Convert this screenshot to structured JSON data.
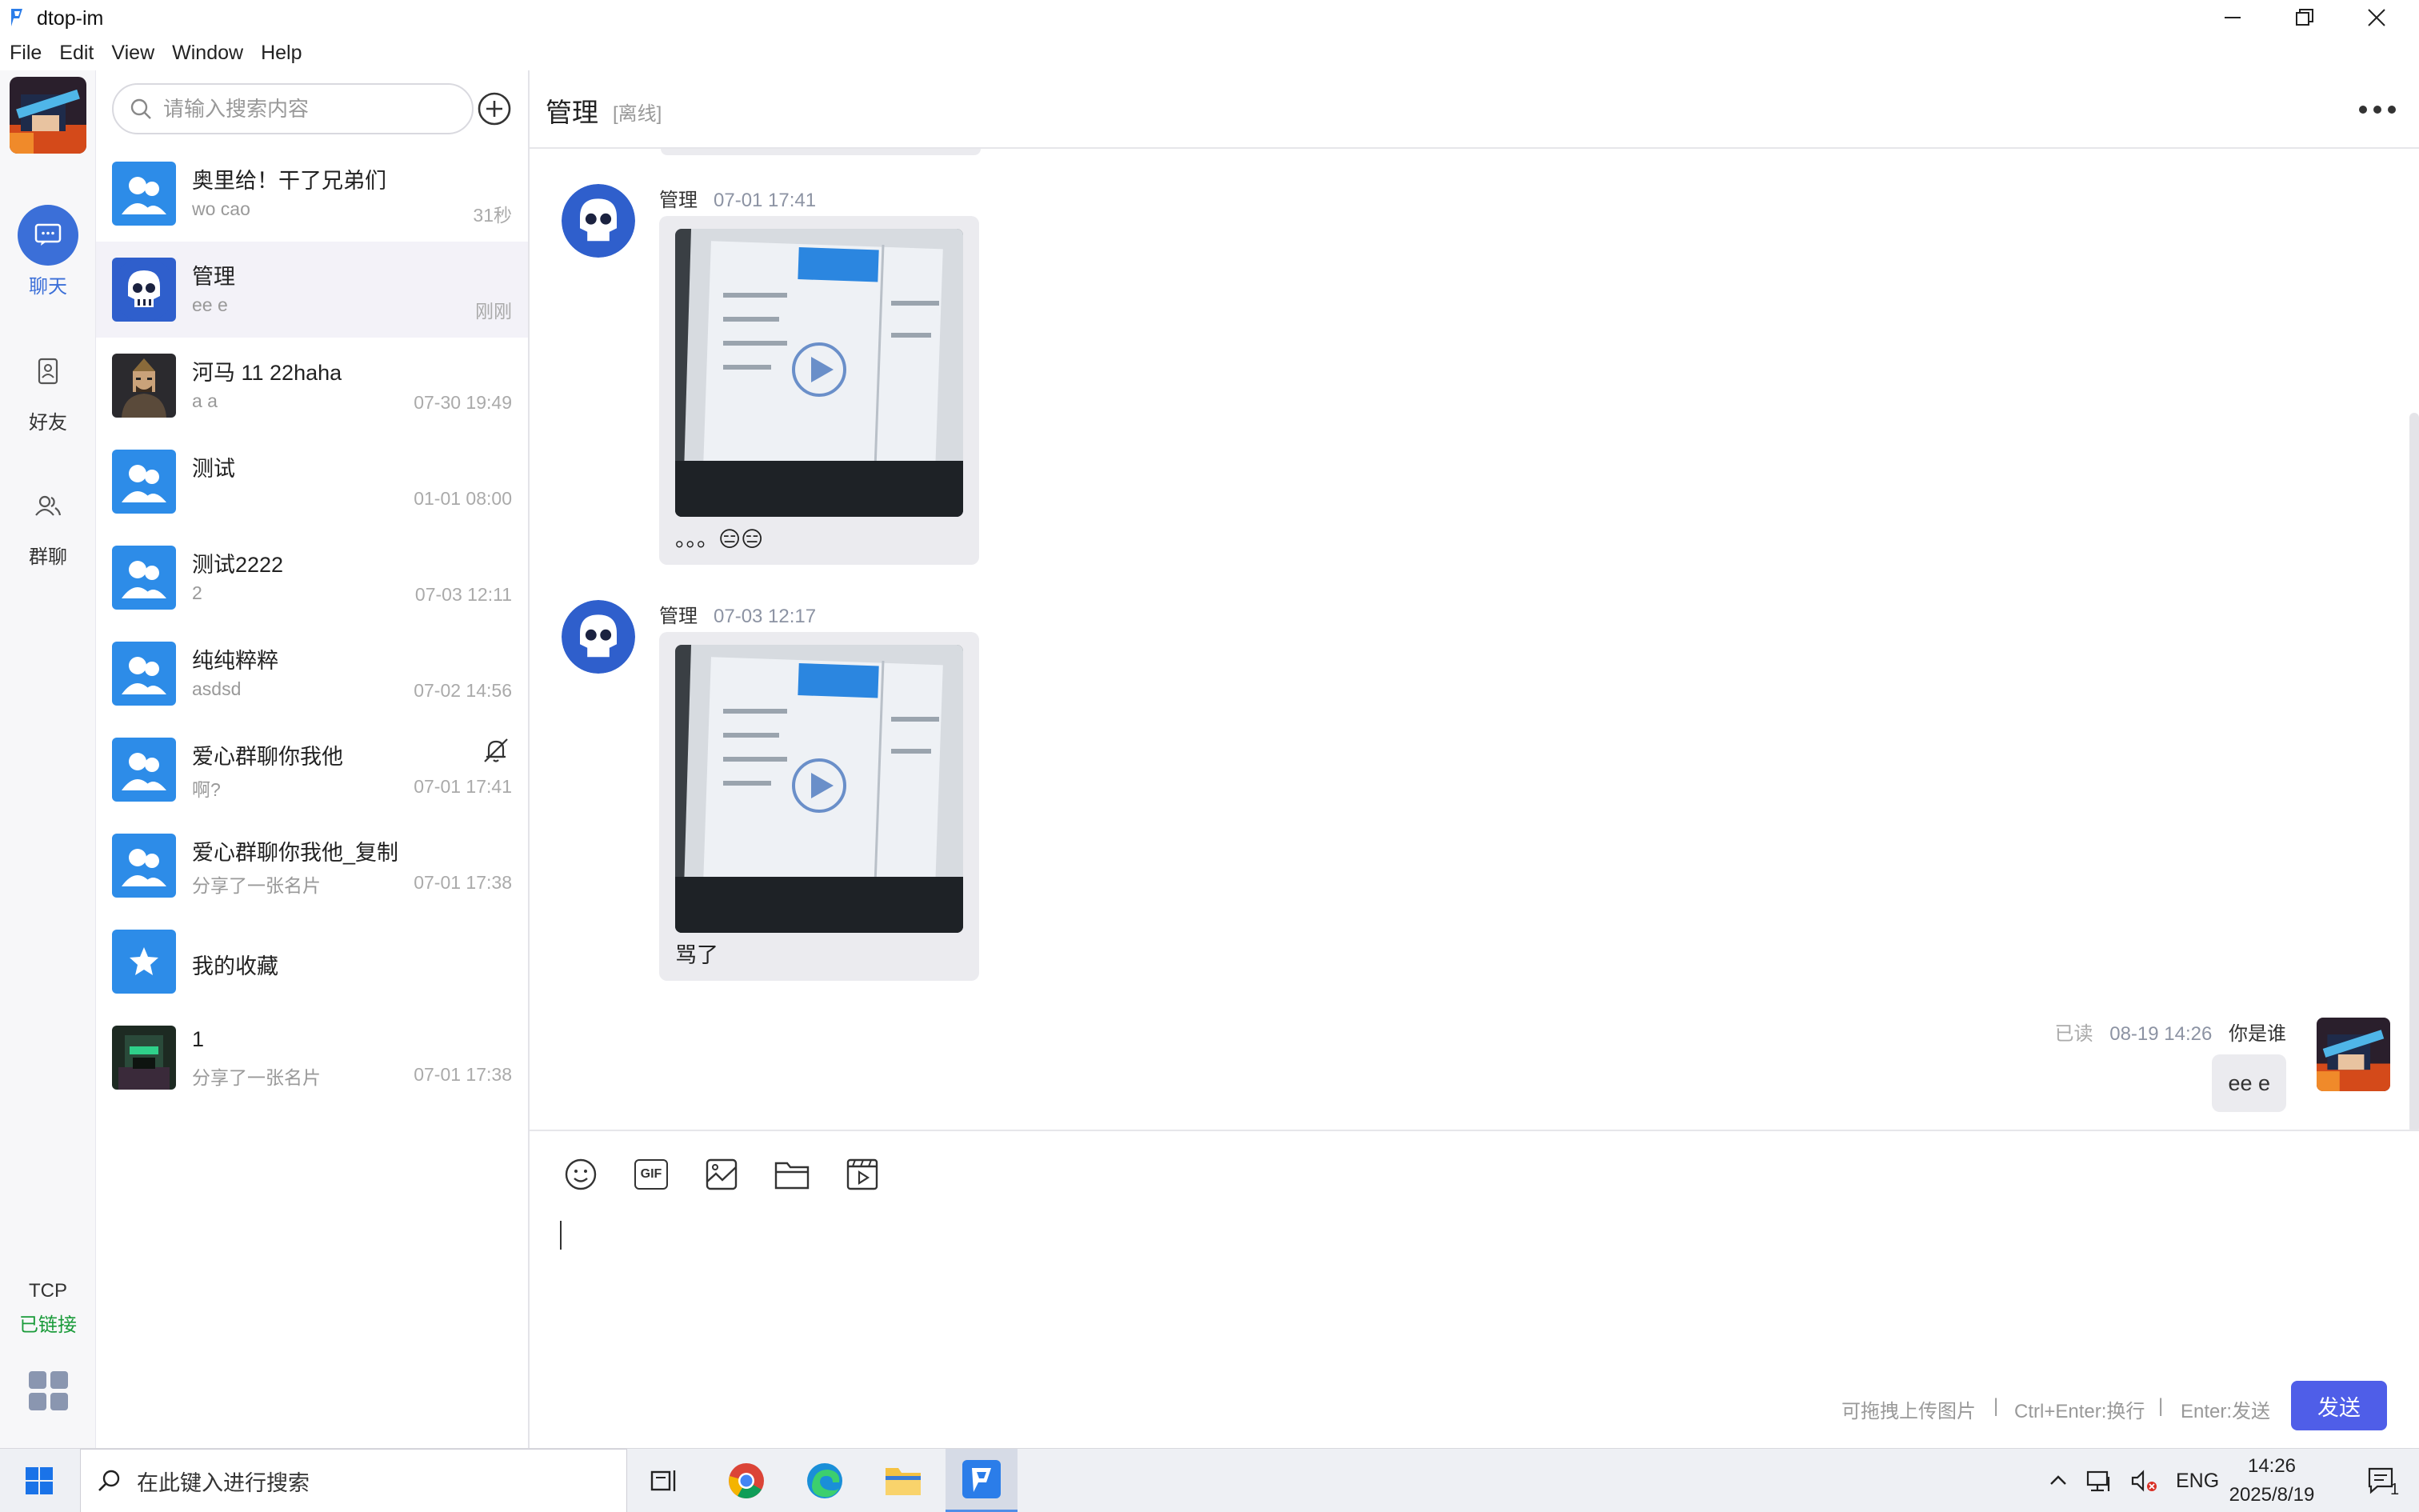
{
  "window": {
    "title": "dtop-im"
  },
  "menu": [
    "File",
    "Edit",
    "View",
    "Window",
    "Help"
  ],
  "nav": {
    "items": [
      {
        "label": "聊天",
        "icon": "chat-icon",
        "active": true
      },
      {
        "label": "好友",
        "icon": "contacts-icon",
        "active": false
      },
      {
        "label": "群聊",
        "icon": "group-icon",
        "active": false
      }
    ],
    "status_label": "TCP",
    "status_value": "已链接"
  },
  "search": {
    "placeholder": "请输入搜索内容"
  },
  "conversations": [
    {
      "name": "奥里给！干了兄弟们",
      "preview": "wo cao",
      "time": "31秒",
      "avatar": "group-avatar",
      "active": false,
      "muted": false
    },
    {
      "name": "管理",
      "preview": "ee e",
      "time": "刚刚",
      "avatar": "skull-avatar",
      "active": true,
      "muted": false
    },
    {
      "name": "河马 11 22haha",
      "preview": "a a",
      "time": "07-30 19:49",
      "avatar": "photo-avatar",
      "active": false,
      "muted": false
    },
    {
      "name": "测试",
      "preview": "",
      "time": "01-01 08:00",
      "avatar": "group-avatar",
      "active": false,
      "muted": false
    },
    {
      "name": "测试2222",
      "preview": "2",
      "time": "07-03 12:11",
      "avatar": "group-avatar",
      "active": false,
      "muted": false
    },
    {
      "name": "纯纯粹粹",
      "preview": "asdsd",
      "time": "07-02 14:56",
      "avatar": "group-avatar",
      "active": false,
      "muted": false
    },
    {
      "name": "爱心群聊你我他",
      "preview": "啊?",
      "time": "07-01 17:41",
      "avatar": "group-avatar",
      "active": false,
      "muted": true
    },
    {
      "name": "爱心群聊你我他_复制",
      "preview": "分享了一张名片",
      "time": "07-01 17:38",
      "avatar": "group-avatar",
      "active": false,
      "muted": false
    },
    {
      "name": "我的收藏",
      "preview": "",
      "time": "",
      "avatar": "star-avatar",
      "active": false,
      "muted": false
    },
    {
      "name": "1",
      "preview": "分享了一张名片",
      "time": "07-01 17:38",
      "avatar": "game-avatar",
      "active": false,
      "muted": false
    }
  ],
  "chat": {
    "title": "管理",
    "status": "[离线]",
    "messages": [
      {
        "sender": "管理",
        "time": "07-01 17:41",
        "type": "video",
        "text": "。。。😑😑"
      },
      {
        "sender": "管理",
        "time": "07-03 12:17",
        "type": "video",
        "text": "骂了"
      }
    ],
    "self_message": {
      "read_status": "已读",
      "time": "08-19 14:26",
      "sender": "你是谁",
      "text": "ee e"
    }
  },
  "composer": {
    "tools": [
      "emoji-icon",
      "gif-icon",
      "image-icon",
      "folder-icon",
      "video-icon"
    ],
    "tools_label": "GIF",
    "hint_upload": "可拖拽上传图片",
    "hint_newline": "Ctrl+Enter:换行",
    "hint_send": "Enter:发送",
    "separator": "|",
    "send_label": "发送"
  },
  "taskbar": {
    "search_placeholder": "在此键入进行搜索",
    "lang": "ENG",
    "time": "14:26",
    "date": "2025/8/19",
    "notification_count": "1"
  },
  "colors": {
    "accent": "#4f5ee8",
    "nav_active": "#3b6fd8",
    "online": "#1a9b3a",
    "group_avatar": "#2d8ce8"
  }
}
